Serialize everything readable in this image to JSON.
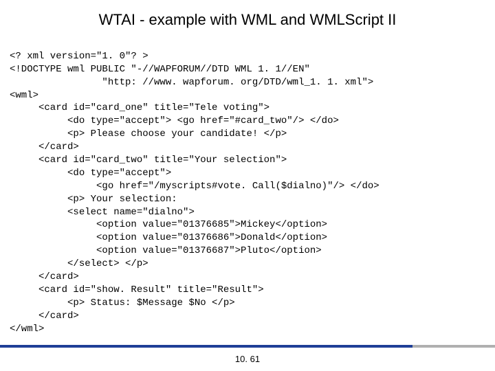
{
  "title": "WTAI - example with WML and WMLScript II",
  "code": {
    "l01": "<? xml version=\"1. 0\"? >",
    "l02": "<!DOCTYPE wml PUBLIC \"-//WAPFORUM//DTD WML 1. 1//EN\"",
    "l03": "                \"http: //www. wapforum. org/DTD/wml_1. 1. xml\">",
    "l04": "<wml>",
    "l05": "     <card id=\"card_one\" title=\"Tele voting\">",
    "l06": "          <do type=\"accept\"> <go href=\"#card_two\"/> </do>",
    "l07": "          <p> Please choose your candidate! </p>",
    "l08": "     </card>",
    "l09": "     <card id=\"card_two\" title=\"Your selection\">",
    "l10": "          <do type=\"accept\">",
    "l11": "               <go href=\"/myscripts#vote. Call($dialno)\"/> </do>",
    "l12": "          <p> Your selection:",
    "l13": "          <select name=\"dialno\">",
    "l14": "               <option value=\"01376685\">Mickey</option>",
    "l15": "               <option value=\"01376686\">Donald</option>",
    "l16": "               <option value=\"01376687\">Pluto</option>",
    "l17": "          </select> </p>",
    "l18": "     </card>",
    "l19": "     <card id=\"show. Result\" title=\"Result\">",
    "l20": "          <p> Status: $Message $No </p>",
    "l21": "     </card>",
    "l22": "</wml>"
  },
  "pagenum": "10. 61"
}
